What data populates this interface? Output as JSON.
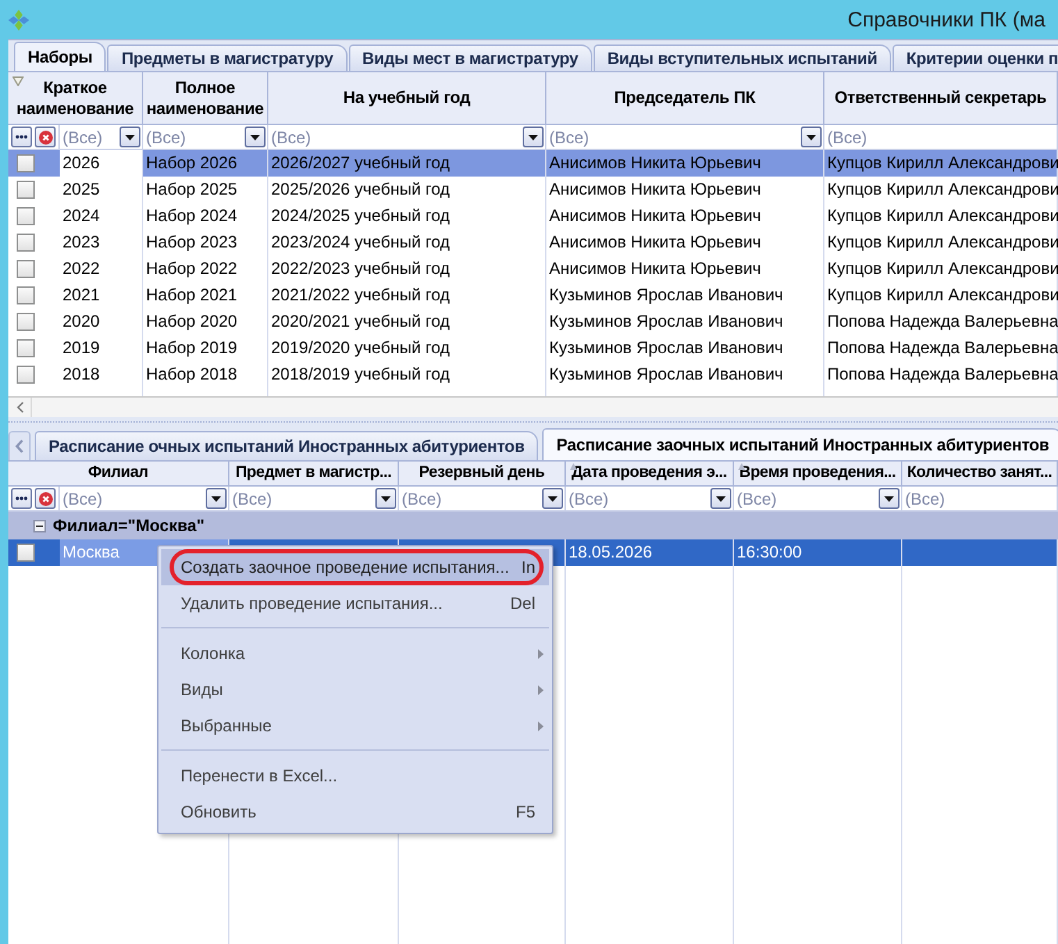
{
  "window": {
    "title": "Справочники ПК (ма"
  },
  "top_tabs": [
    {
      "label": "Наборы",
      "selected": true
    },
    {
      "label": "Предметы в магистратуру",
      "selected": false
    },
    {
      "label": "Виды мест в магистратуру",
      "selected": false
    },
    {
      "label": "Виды вступительных испытаний",
      "selected": false
    },
    {
      "label": "Критерии оценки п",
      "selected": false
    }
  ],
  "top_grid": {
    "active": false,
    "filter_indicator": true,
    "columns": [
      {
        "label": "Краткое наименование",
        "filter": "(Все)",
        "dropdown": true,
        "focused": true
      },
      {
        "label": "Полное наименование",
        "filter": "(Все)",
        "dropdown": true,
        "focused": false
      },
      {
        "label": "На учебный год",
        "filter": "(Все)",
        "dropdown": true,
        "focused": false
      },
      {
        "label": "Председатель ПК",
        "filter": "(Все)",
        "dropdown": true,
        "focused": false
      },
      {
        "label": "Ответственный секретарь",
        "filter": "(Все)",
        "dropdown": false,
        "focused": false
      }
    ],
    "rows": [
      {
        "checked": false,
        "selected": true,
        "cells": [
          "2026",
          "Набор 2026",
          "2026/2027 учебный год",
          "Анисимов Никита Юрьевич",
          "Купцов Кирилл Александрови"
        ]
      },
      {
        "checked": false,
        "selected": false,
        "cells": [
          "2025",
          "Набор 2025",
          "2025/2026 учебный год",
          "Анисимов Никита Юрьевич",
          "Купцов Кирилл Александрови"
        ]
      },
      {
        "checked": false,
        "selected": false,
        "cells": [
          "2024",
          "Набор 2024",
          "2024/2025 учебный год",
          "Анисимов Никита Юрьевич",
          "Купцов Кирилл Александрови"
        ]
      },
      {
        "checked": false,
        "selected": false,
        "cells": [
          "2023",
          "Набор 2023",
          "2023/2024 учебный год",
          "Анисимов Никита Юрьевич",
          "Купцов Кирилл Александрови"
        ]
      },
      {
        "checked": false,
        "selected": false,
        "cells": [
          "2022",
          "Набор 2022",
          "2022/2023 учебный год",
          "Анисимов Никита Юрьевич",
          "Купцов Кирилл Александрови"
        ]
      },
      {
        "checked": false,
        "selected": false,
        "cells": [
          "2021",
          "Набор 2021",
          "2021/2022 учебный год",
          "Кузьминов Ярослав Иванович",
          "Купцов Кирилл Александрови"
        ]
      },
      {
        "checked": false,
        "selected": false,
        "cells": [
          "2020",
          "Набор 2020",
          "2020/2021 учебный год",
          "Кузьминов Ярослав Иванович",
          "Попова Надежда Валерьевна"
        ]
      },
      {
        "checked": false,
        "selected": false,
        "cells": [
          "2019",
          "Набор 2019",
          "2019/2020 учебный год",
          "Кузьминов Ярослав Иванович",
          "Попова Надежда Валерьевна"
        ]
      },
      {
        "checked": false,
        "selected": false,
        "cells": [
          "2018",
          "Набор 2018",
          "2018/2019 учебный год",
          "Кузьминов Ярослав Иванович",
          "Попова Надежда Валерьевна"
        ]
      }
    ]
  },
  "bottom_tabs": [
    {
      "label": "Расписание очных испытаний Иностранных абитуриентов",
      "selected": false
    },
    {
      "label": "Расписание заочных испытаний Иностранных абитуриентов",
      "selected": true
    }
  ],
  "bottom_grid": {
    "active": true,
    "columns": [
      {
        "label": "Филиал",
        "filter": "(Все)",
        "dropdown": true,
        "focused": true,
        "sorted": false
      },
      {
        "label": "Предмет в магистр...",
        "filter": "(Все)",
        "dropdown": true,
        "focused": false,
        "sorted": false
      },
      {
        "label": "Резервный день",
        "filter": "(Все)",
        "dropdown": true,
        "focused": false,
        "sorted": false
      },
      {
        "label": "Дата проведения э...",
        "filter": "(Все)",
        "dropdown": true,
        "focused": false,
        "sorted": true
      },
      {
        "label": "Время проведения...",
        "filter": "(Все)",
        "dropdown": true,
        "focused": false,
        "sorted": true
      },
      {
        "label": "Количество занят...",
        "filter": "(Все)",
        "dropdown": false,
        "focused": false,
        "sorted": false
      }
    ],
    "group": {
      "label": "Филиал=\"Москва\"",
      "expanded": true
    },
    "rows": [
      {
        "checked": false,
        "selected": true,
        "cells": [
          "Москва",
          null,
          null,
          "18.05.2026",
          "16:30:00",
          null
        ]
      }
    ]
  },
  "context_menu": {
    "items": [
      {
        "kind": "item",
        "label": "Создать заочное проведение испытания...",
        "shortcut": "In",
        "submenu": false,
        "selected": true,
        "circled": true
      },
      {
        "kind": "item",
        "label": "Удалить проведение испытания...",
        "shortcut": "Del",
        "submenu": false,
        "selected": false,
        "circled": false
      },
      {
        "kind": "separator"
      },
      {
        "kind": "item",
        "label": "Колонка",
        "submenu": true,
        "selected": false,
        "circled": false
      },
      {
        "kind": "item",
        "label": "Виды",
        "submenu": true,
        "selected": false,
        "circled": false
      },
      {
        "kind": "item",
        "label": "Выбранные",
        "submenu": true,
        "selected": false,
        "circled": false
      },
      {
        "kind": "separator"
      },
      {
        "kind": "item",
        "label": "Перенести в Excel...",
        "submenu": false,
        "selected": false,
        "circled": false
      },
      {
        "kind": "item",
        "label": "Обновить",
        "shortcut": "F5",
        "submenu": false,
        "selected": false,
        "circled": false
      }
    ]
  }
}
